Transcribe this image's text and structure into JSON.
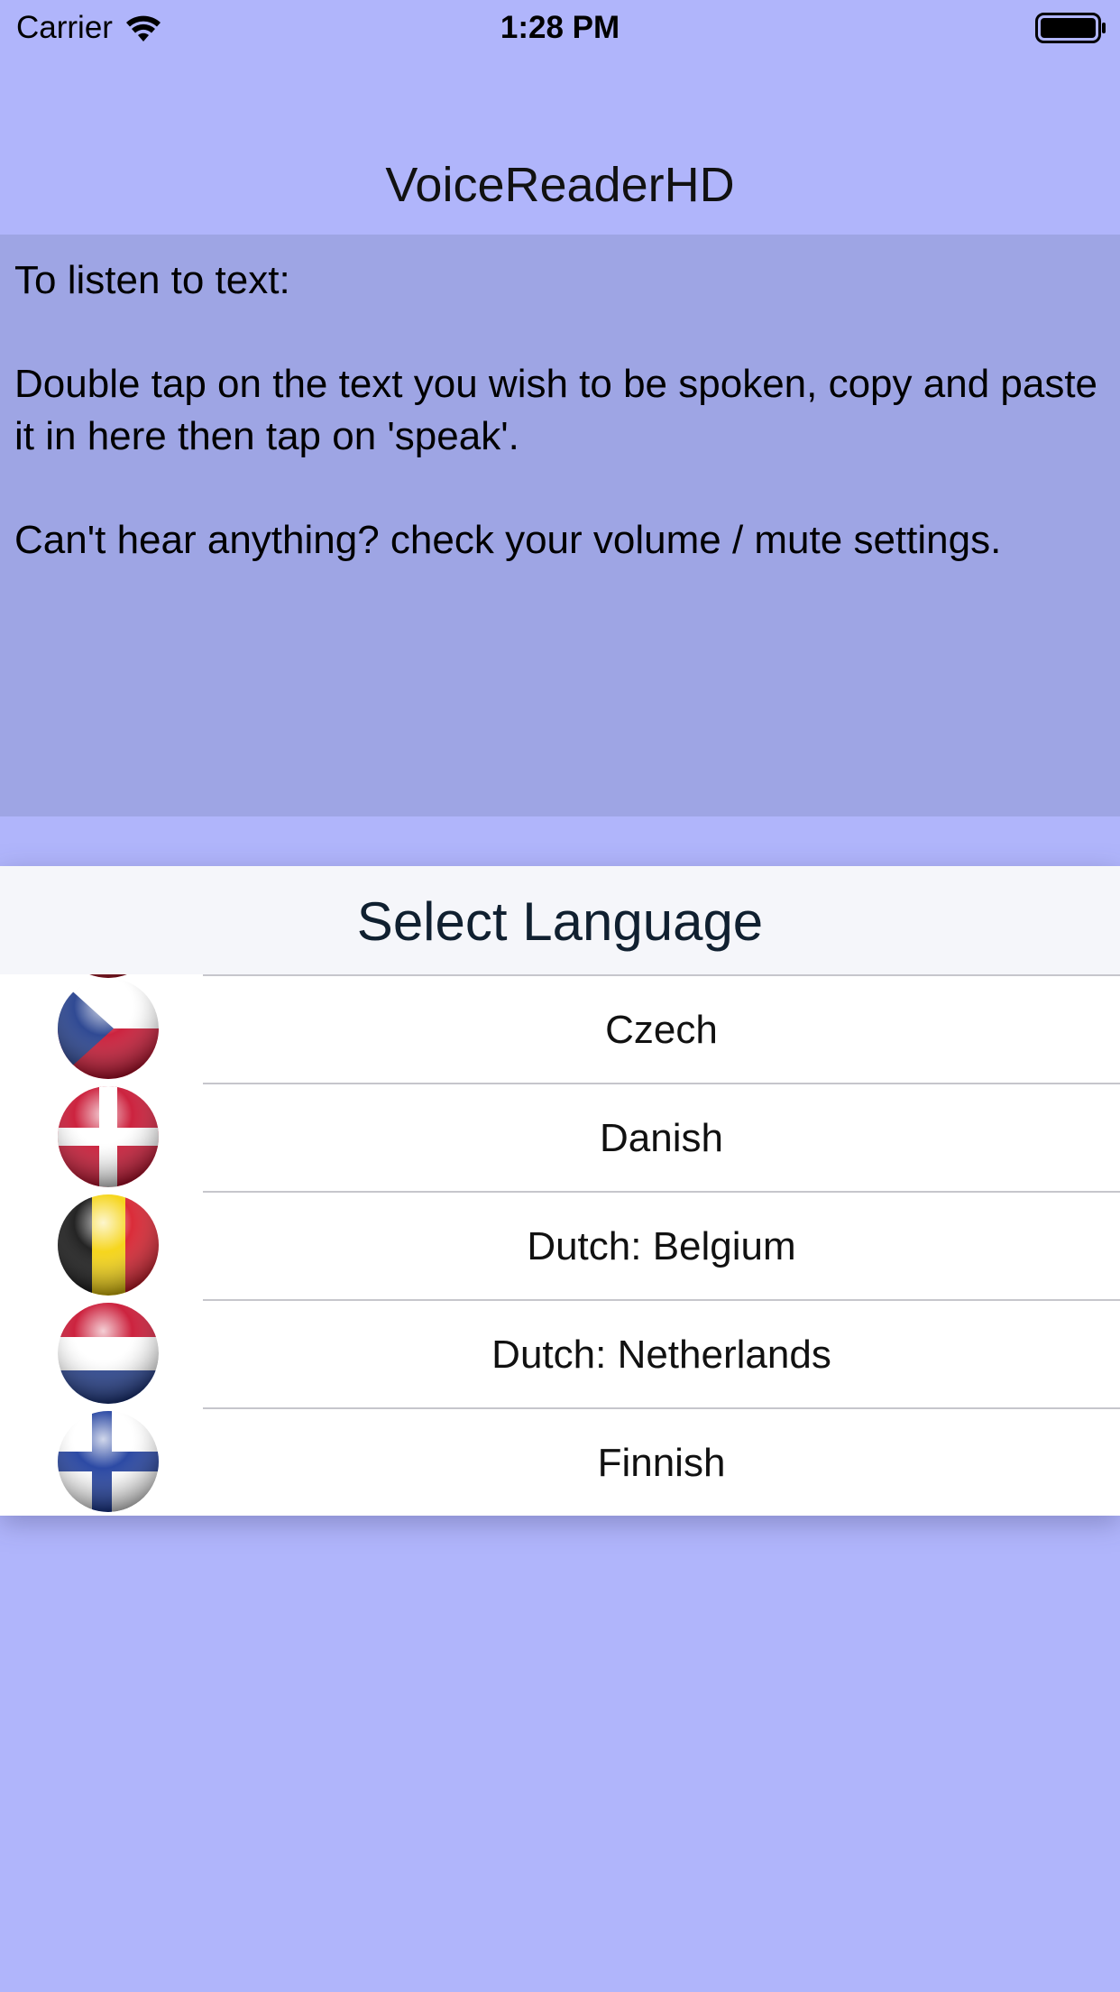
{
  "status_bar": {
    "carrier": "Carrier",
    "time": "1:28 PM"
  },
  "nav": {
    "title": "VoiceReaderHD"
  },
  "text_area": {
    "content": "To listen to text:\n\nDouble tap on the text you wish to be spoken, copy and paste it in here then tap on 'speak'.\n\nCan't hear anything? check your volume / mute settings."
  },
  "picker": {
    "title": "Select Language",
    "items": [
      {
        "label": "Czech",
        "icon": "czech-flag-icon"
      },
      {
        "label": "Danish",
        "icon": "danish-flag-icon"
      },
      {
        "label": "Dutch: Belgium",
        "icon": "belgium-flag-icon"
      },
      {
        "label": "Dutch: Netherlands",
        "icon": "netherlands-flag-icon"
      },
      {
        "label": "Finnish",
        "icon": "finland-flag-icon"
      }
    ]
  },
  "colors": {
    "background": "#b0b5fb",
    "text_panel": "#9ea5e4",
    "picker_header": "#f5f6fa"
  }
}
